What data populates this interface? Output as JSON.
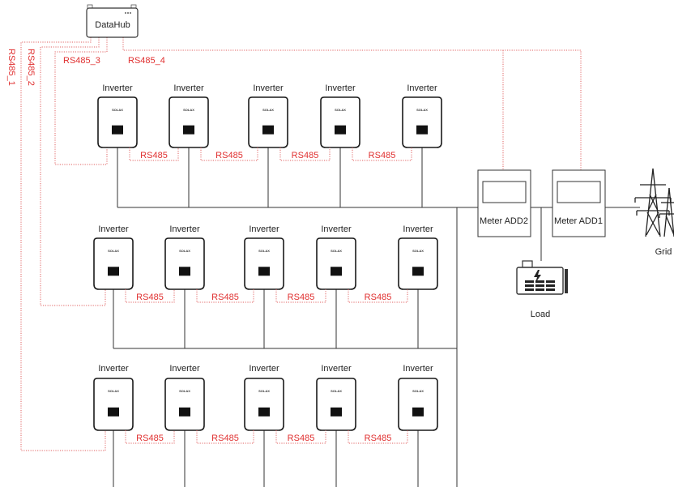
{
  "datahub": {
    "label": "DataHub",
    "port_label_1": "RS485_1",
    "port_label_2": "RS485_2",
    "port_label_3": "RS485_3",
    "port_label_4": "RS485_4"
  },
  "inverter": {
    "label": "Inverter",
    "logo_text": "SOLAX"
  },
  "chain_link_label": "RS485",
  "meters": [
    {
      "label": "Meter ADD2"
    },
    {
      "label": "Meter ADD1"
    }
  ],
  "load": {
    "label": "Load"
  },
  "grid": {
    "label": "Grid"
  },
  "rows": [
    {
      "inverters": 5,
      "links": 4
    },
    {
      "inverters": 5,
      "links": 4
    },
    {
      "inverters": 5,
      "links": 4
    }
  ],
  "colors": {
    "rs485_wire": "#e06060",
    "rs485_label": "#e03030",
    "power_line": "#333333"
  }
}
